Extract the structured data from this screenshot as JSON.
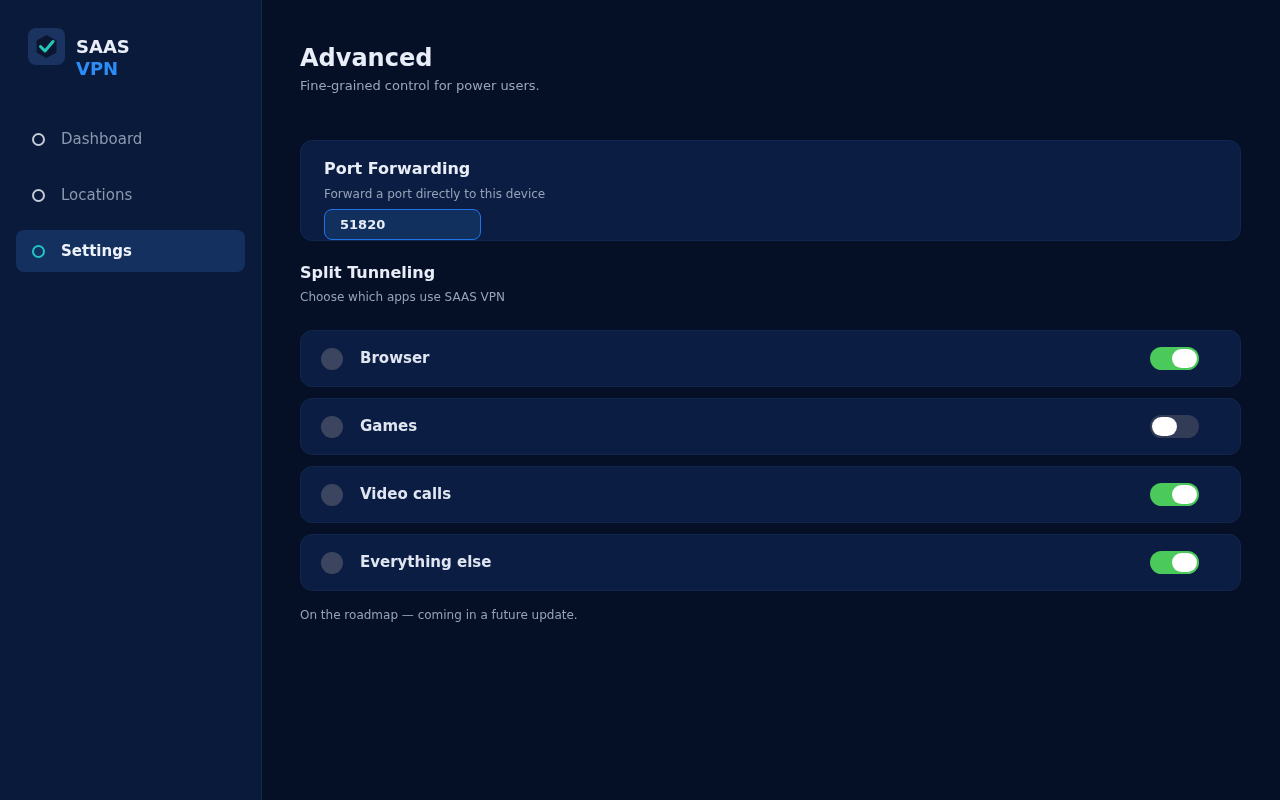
{
  "sidebar": {
    "brand": {
      "line_1": "SAAS",
      "line_2": "VPN"
    },
    "items": [
      {
        "label": "Dashboard",
        "selected": false
      },
      {
        "label": "Locations",
        "selected": false
      },
      {
        "label": "Settings",
        "selected": true
      }
    ]
  },
  "page": {
    "title": "Advanced",
    "subtitle": "Fine-grained control for power users."
  },
  "port_forwarding": {
    "title": "Port Forwarding",
    "description": "Forward a port directly to this device",
    "port": {
      "value": "51820"
    }
  },
  "split_tunneling": {
    "title": "Split Tunneling",
    "description": "Choose which apps use SAAS VPN",
    "apps": [
      {
        "label": "Browser",
        "on": true
      },
      {
        "label": "Games",
        "on": false
      },
      {
        "label": "Video calls",
        "on": true
      },
      {
        "label": "Everything else",
        "on": true
      }
    ]
  },
  "footnote": "On the roadmap — coming in a future update."
}
